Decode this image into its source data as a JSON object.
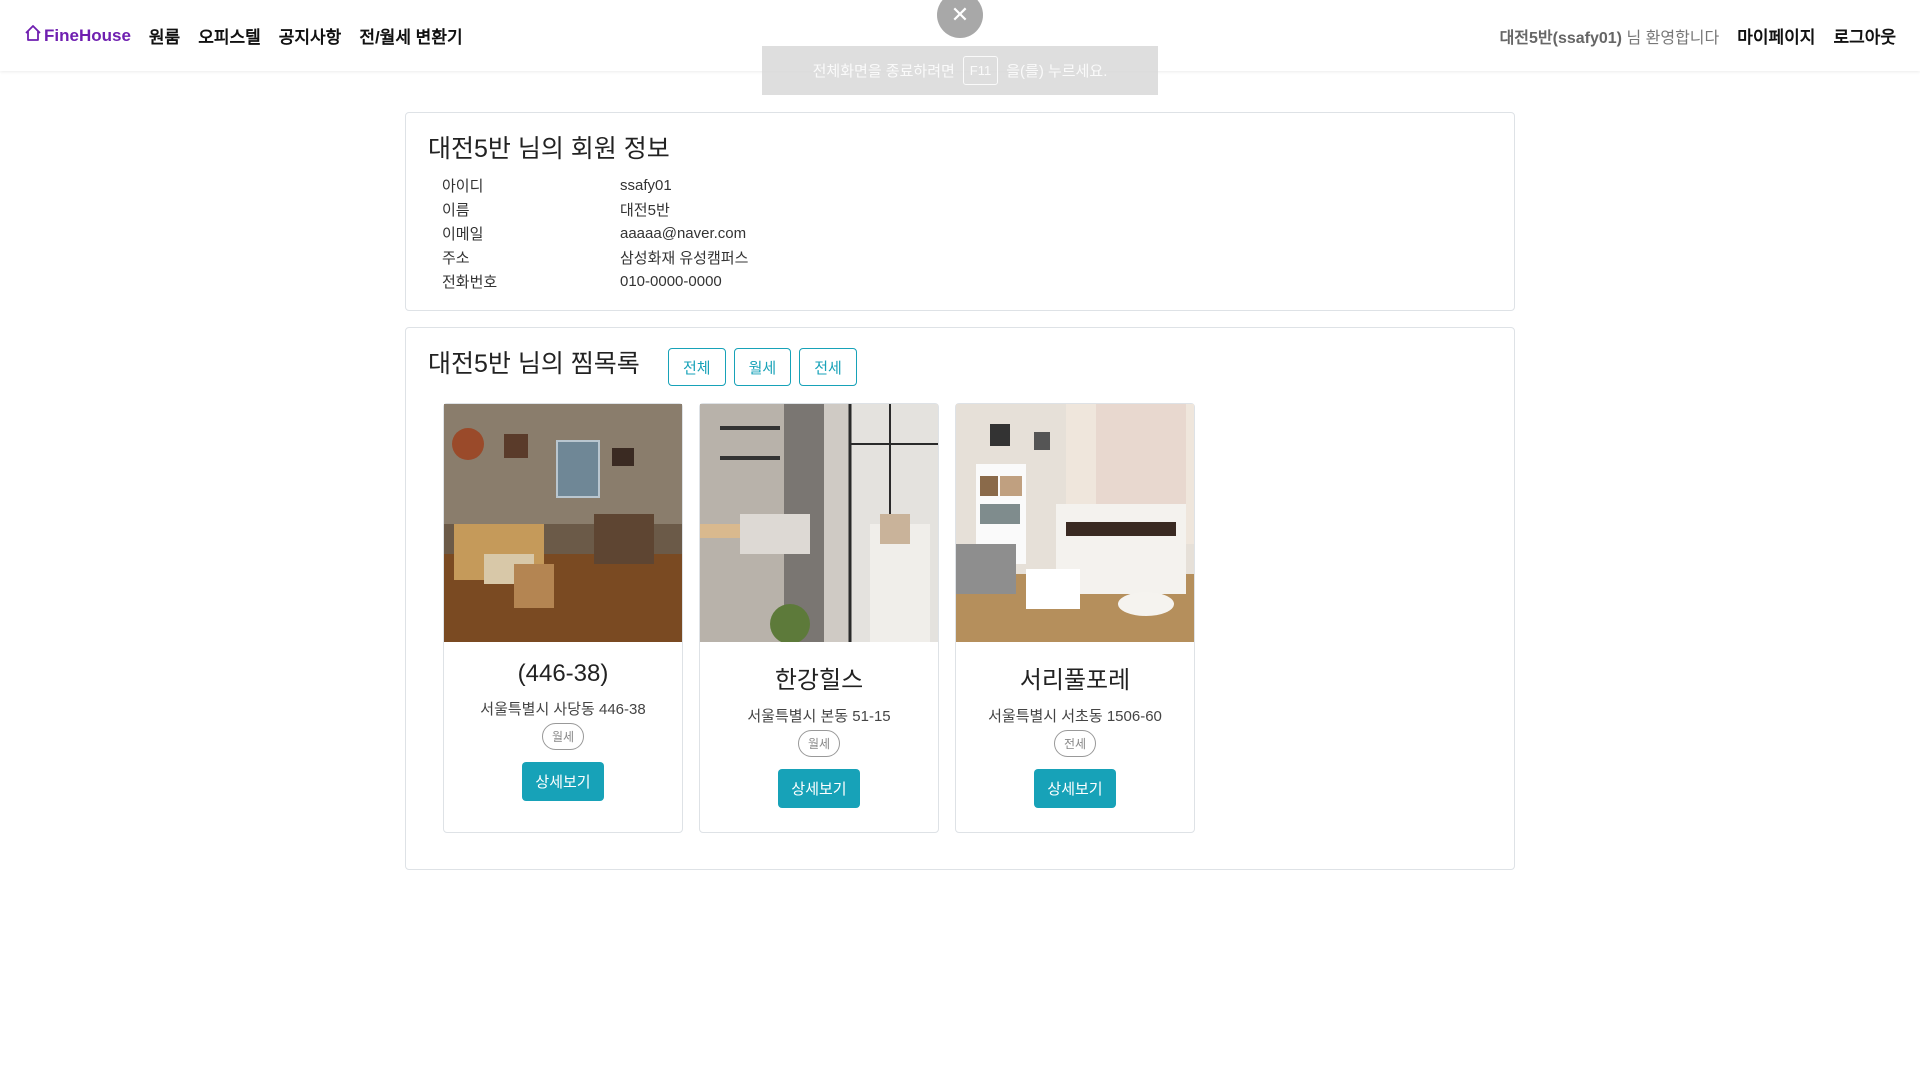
{
  "navbar": {
    "brand": "FineHouse",
    "links": [
      "원룸",
      "오피스텔",
      "공지사항",
      "전/월세 변환기"
    ],
    "welcome_name": "대전5반(ssafy01)",
    "welcome_suffix": " 님 환영합니다",
    "mypage": "마이페이지",
    "logout": "로그아웃"
  },
  "fullscreen": {
    "close_symbol": "✕",
    "msg_before": "전체화면을 종료하려면",
    "key": "F11",
    "msg_after": "을(를) 누르세요."
  },
  "member": {
    "title": "대전5반 님의 회원 정보",
    "rows": [
      {
        "label": "아이디",
        "value": "ssafy01"
      },
      {
        "label": "이름",
        "value": "대전5반"
      },
      {
        "label": "이메일",
        "value": "aaaaa@naver.com"
      },
      {
        "label": "주소",
        "value": "삼성화재 유성캠퍼스"
      },
      {
        "label": "전화번호",
        "value": "010-0000-0000"
      }
    ]
  },
  "wishlist": {
    "title": "대전5반 님의 찜목록",
    "filters": [
      "전체",
      "월세",
      "전세"
    ],
    "detail_label": "상세보기",
    "items": [
      {
        "name": "(446-38)",
        "address": "서울특별시 사당동 446-38",
        "type": "월세",
        "image_icon": "room-photo-living"
      },
      {
        "name": "한강힐스",
        "address": "서울특별시 본동 51-15",
        "type": "월세",
        "image_icon": "room-photo-kitchen"
      },
      {
        "name": "서리풀포레",
        "address": "서울특별시 서초동 1506-60",
        "type": "전세",
        "image_icon": "room-photo-bedroom"
      }
    ]
  },
  "colors": {
    "brand": "#6f1fb0",
    "accent": "#17a2b8",
    "indicator": "#2c6db5"
  }
}
